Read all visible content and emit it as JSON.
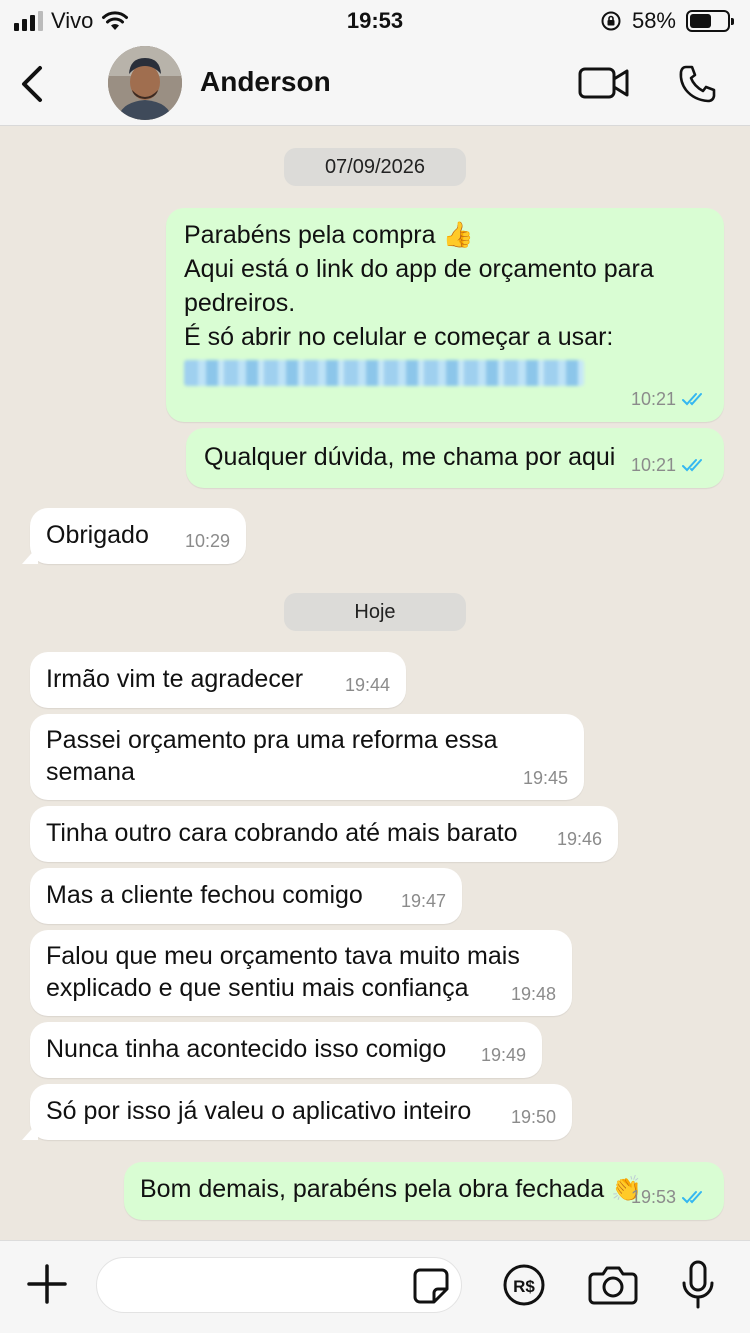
{
  "status_bar": {
    "carrier": "Vivo",
    "time": "19:53",
    "battery_percent": "58%",
    "battery_level": 0.58
  },
  "header": {
    "contact_name": "Anderson"
  },
  "messages": [
    {
      "type": "date",
      "text": "07/09/2026"
    },
    {
      "type": "out",
      "lines": [
        "Parabéns pela compra 👍",
        "Aqui está o link do app de orçamento para",
        "pedreiros.",
        "É só abrir no celular e começar a usar:"
      ],
      "time": "10:21",
      "status": "read"
    },
    {
      "type": "out",
      "text": "Qualquer dúvida, me chama por aqui",
      "time": "10:21",
      "status": "read"
    },
    {
      "type": "in",
      "text": "Obrigado",
      "time": "10:29"
    },
    {
      "type": "date",
      "text": "Hoje"
    },
    {
      "type": "in",
      "text": "Irmão vim te agradecer",
      "time": "19:44"
    },
    {
      "type": "in",
      "lines": [
        "Passei orçamento pra uma reforma essa",
        "semana"
      ],
      "time": "19:45"
    },
    {
      "type": "in",
      "text": "Tinha outro cara cobrando até mais barato",
      "time": "19:46"
    },
    {
      "type": "in",
      "text": "Mas a cliente fechou comigo",
      "time": "19:47"
    },
    {
      "type": "in",
      "lines": [
        "Falou que meu orçamento tava muito mais",
        "explicado e que sentiu mais confiança"
      ],
      "time": "19:48"
    },
    {
      "type": "in",
      "text": "Nunca tinha acontecido isso comigo",
      "time": "19:49"
    },
    {
      "type": "in",
      "text": "Só por isso já valeu o aplicativo inteiro",
      "time": "19:50"
    },
    {
      "type": "out",
      "text": "Bom demais, parabéns pela obra fechada 👏",
      "time": "19:53",
      "status": "read"
    }
  ],
  "composer": {
    "placeholder": "",
    "pay_label": "R$"
  },
  "colors": {
    "outgoing_bubble": "#d9fdd3",
    "incoming_bubble": "#ffffff",
    "chat_background": "#ece7df",
    "read_ticks": "#34b7f1"
  }
}
